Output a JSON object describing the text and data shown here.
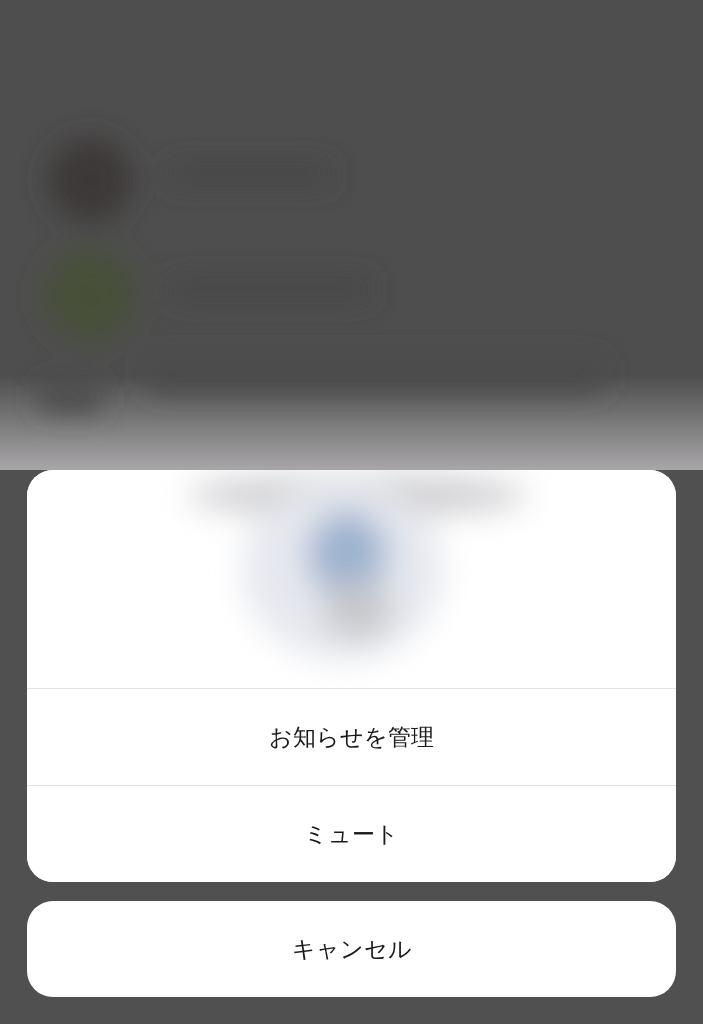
{
  "actions": [
    {
      "label": "お知らせを管理"
    },
    {
      "label": "ミュート"
    }
  ],
  "cancel": {
    "label": "キャンセル"
  }
}
